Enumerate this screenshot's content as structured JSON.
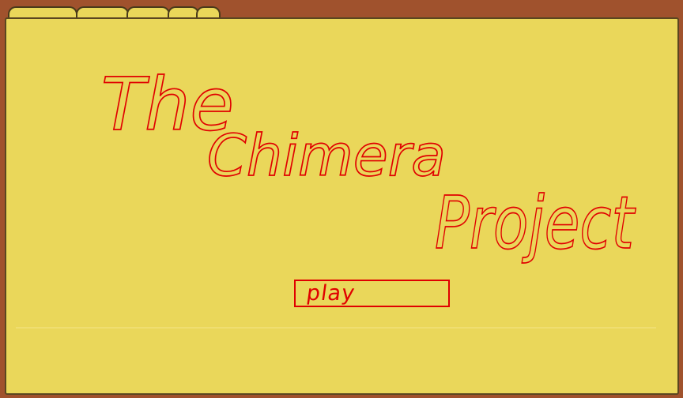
{
  "game": {
    "title": {
      "line1": "The",
      "line2": "Chimera",
      "line3": "Project"
    },
    "play_label": "play"
  },
  "colors": {
    "card": "#ead75a",
    "background": "#a0522d",
    "ink": "#e00000",
    "border": "#5b4620"
  }
}
